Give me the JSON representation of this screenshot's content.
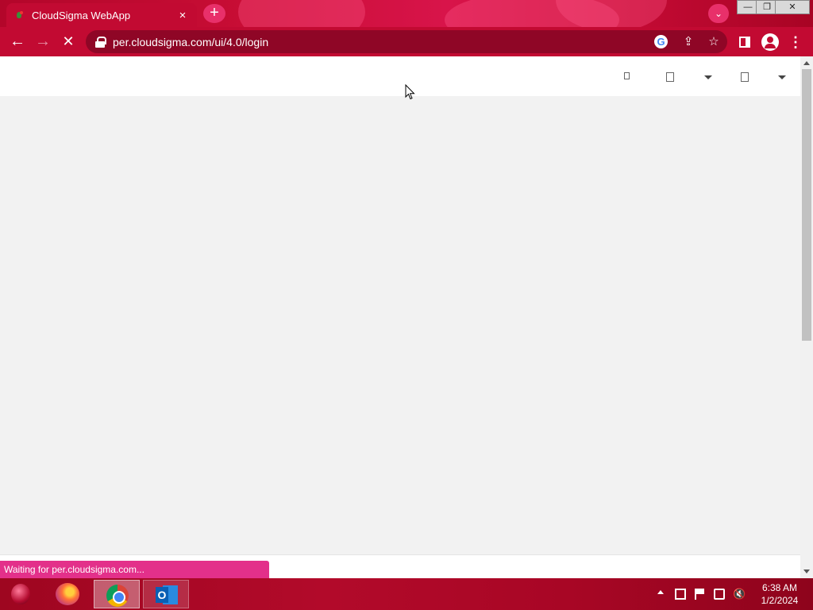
{
  "browser": {
    "tab": {
      "title": "CloudSigma WebApp",
      "close": "×"
    },
    "new_tab": "+",
    "tab_search": "⌄",
    "window_controls": {
      "minimize": "—",
      "maximize": "❐",
      "close": "✕"
    },
    "nav": {
      "back": "←",
      "forward": "→",
      "stop": "✕"
    },
    "address": "per.cloudsigma.com/ui/4.0/login",
    "icons": {
      "google": "G",
      "share": "⇪",
      "star": "☆",
      "menu": "⋮"
    },
    "status": "Waiting for per.cloudsigma.com..."
  },
  "colors": {
    "chrome_red": "#c20a32",
    "omnibox": "#8f0626",
    "status_bubble": "#e3308a",
    "page_bg": "#f2f2f2"
  },
  "taskbar": {
    "apps": [
      {
        "name": "start-orb-icon"
      },
      {
        "name": "firefox-icon"
      },
      {
        "name": "chrome-icon",
        "active": true
      },
      {
        "name": "outlook-icon",
        "letter": "O"
      }
    ],
    "tray": {
      "mute": "🔇"
    },
    "clock": {
      "time": "6:38 AM",
      "date": "1/2/2024"
    }
  }
}
